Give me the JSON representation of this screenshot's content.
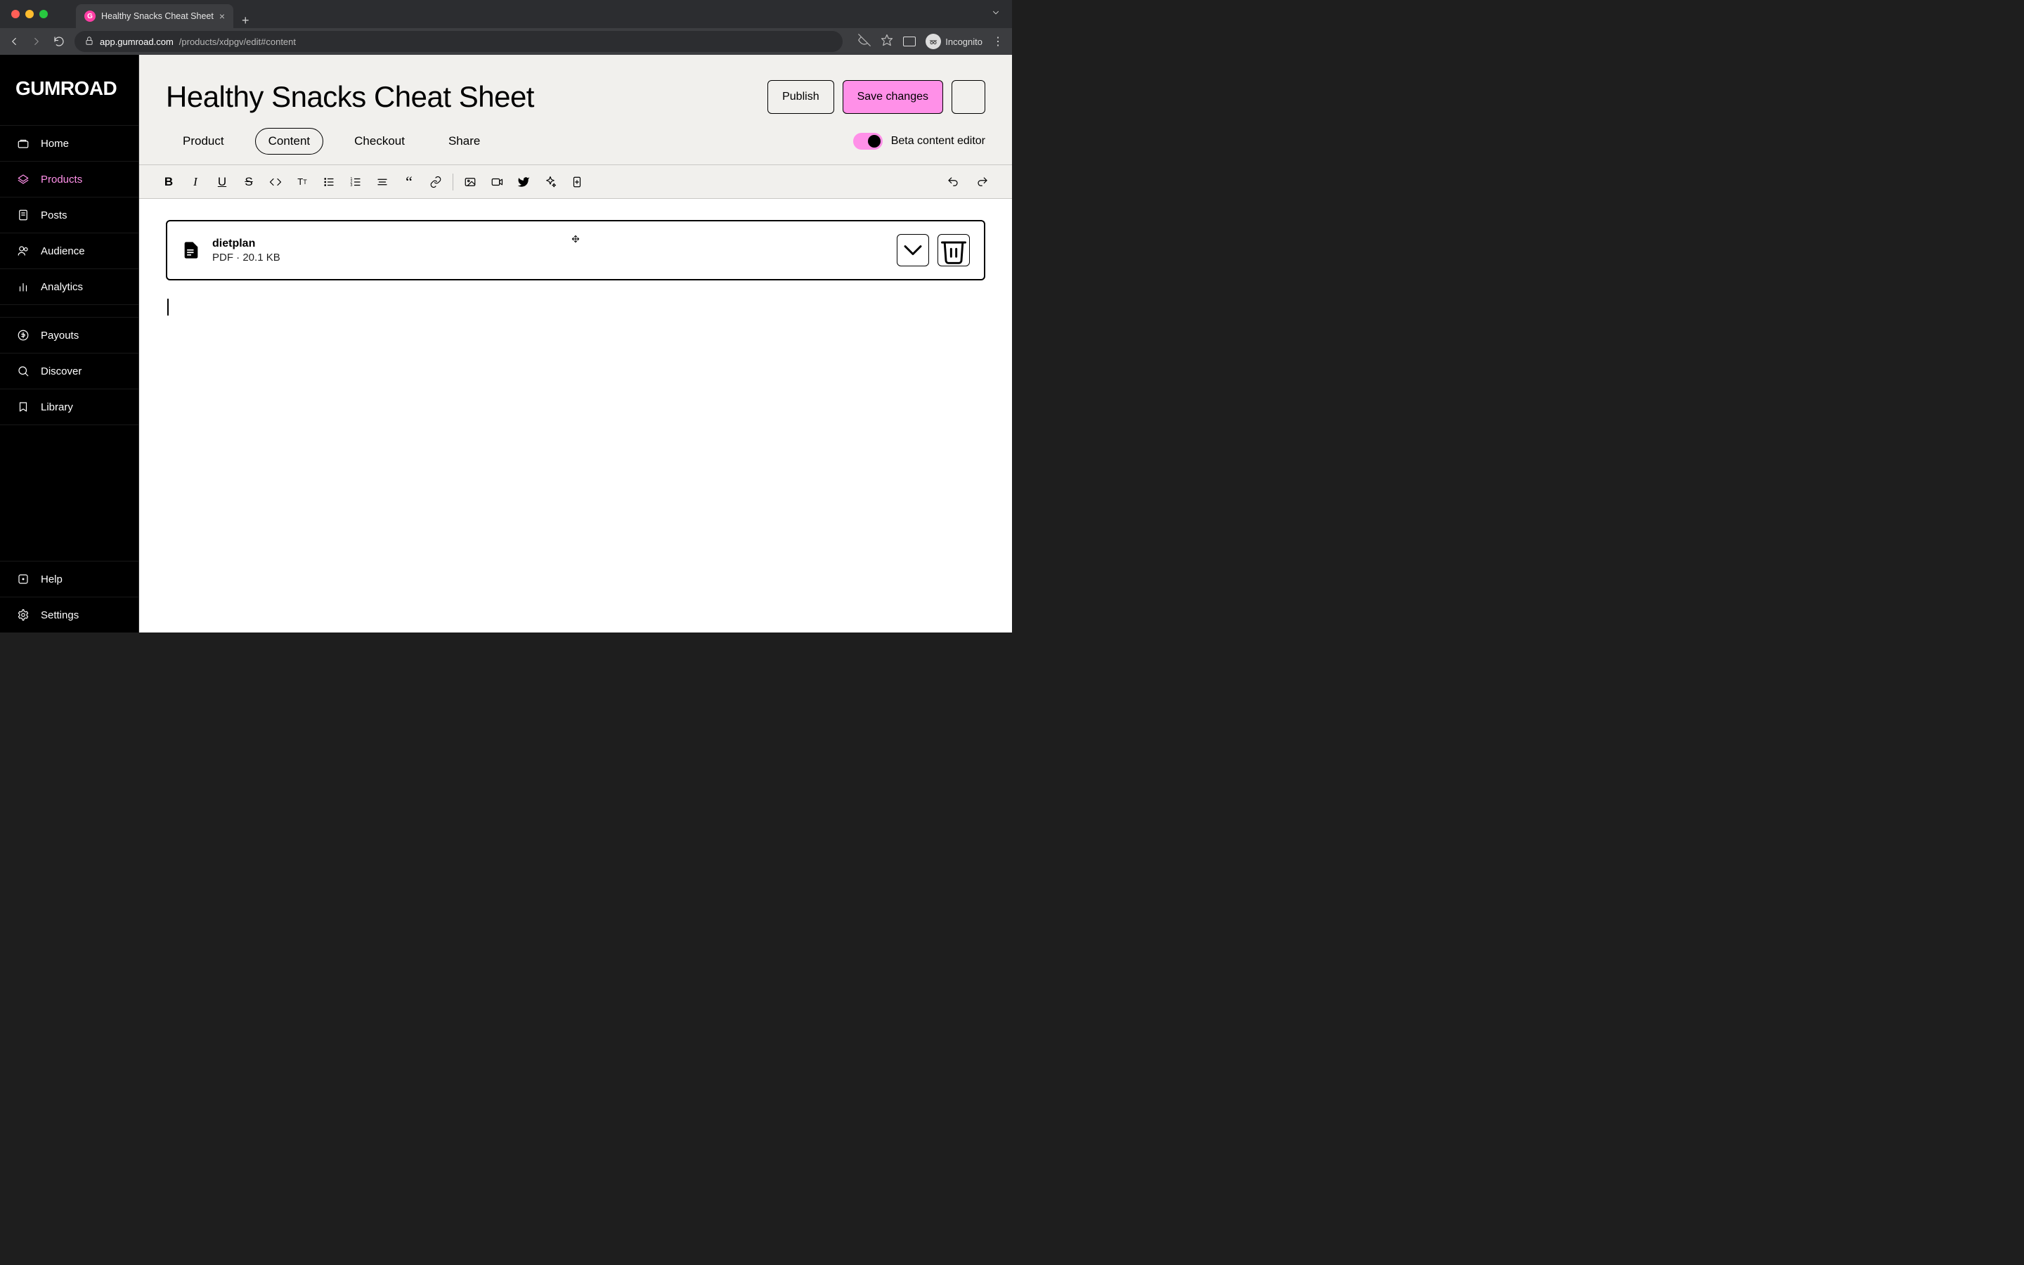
{
  "browser": {
    "tab_title": "Healthy Snacks Cheat Sheet",
    "url_domain": "app.gumroad.com",
    "url_path": "/products/xdpgv/edit#content",
    "profile_label": "Incognito"
  },
  "sidebar": {
    "logo": "GUMROAD",
    "items": [
      {
        "label": "Home",
        "icon": "home-icon"
      },
      {
        "label": "Products",
        "icon": "products-icon",
        "active": true
      },
      {
        "label": "Posts",
        "icon": "posts-icon"
      },
      {
        "label": "Audience",
        "icon": "audience-icon"
      },
      {
        "label": "Analytics",
        "icon": "analytics-icon"
      }
    ],
    "items2": [
      {
        "label": "Payouts",
        "icon": "payouts-icon"
      },
      {
        "label": "Discover",
        "icon": "discover-icon"
      },
      {
        "label": "Library",
        "icon": "library-icon"
      }
    ],
    "items3": [
      {
        "label": "Help",
        "icon": "help-icon"
      },
      {
        "label": "Settings",
        "icon": "settings-icon"
      }
    ]
  },
  "header": {
    "page_title": "Healthy Snacks Cheat Sheet",
    "publish_label": "Publish",
    "save_label": "Save changes"
  },
  "tabs": {
    "items": [
      {
        "label": "Product"
      },
      {
        "label": "Content",
        "active": true
      },
      {
        "label": "Checkout"
      },
      {
        "label": "Share"
      }
    ],
    "beta_label": "Beta content editor"
  },
  "toolbar": {
    "group1": [
      "bold",
      "italic",
      "underline",
      "strike",
      "code",
      "text-size",
      "ul",
      "ol",
      "align",
      "quote",
      "link"
    ],
    "group2": [
      "image",
      "video",
      "twitter",
      "ai",
      "page"
    ],
    "history": [
      "undo",
      "redo"
    ]
  },
  "file": {
    "name": "dietplan",
    "type": "PDF",
    "sep": " · ",
    "size": "20.1 KB"
  }
}
